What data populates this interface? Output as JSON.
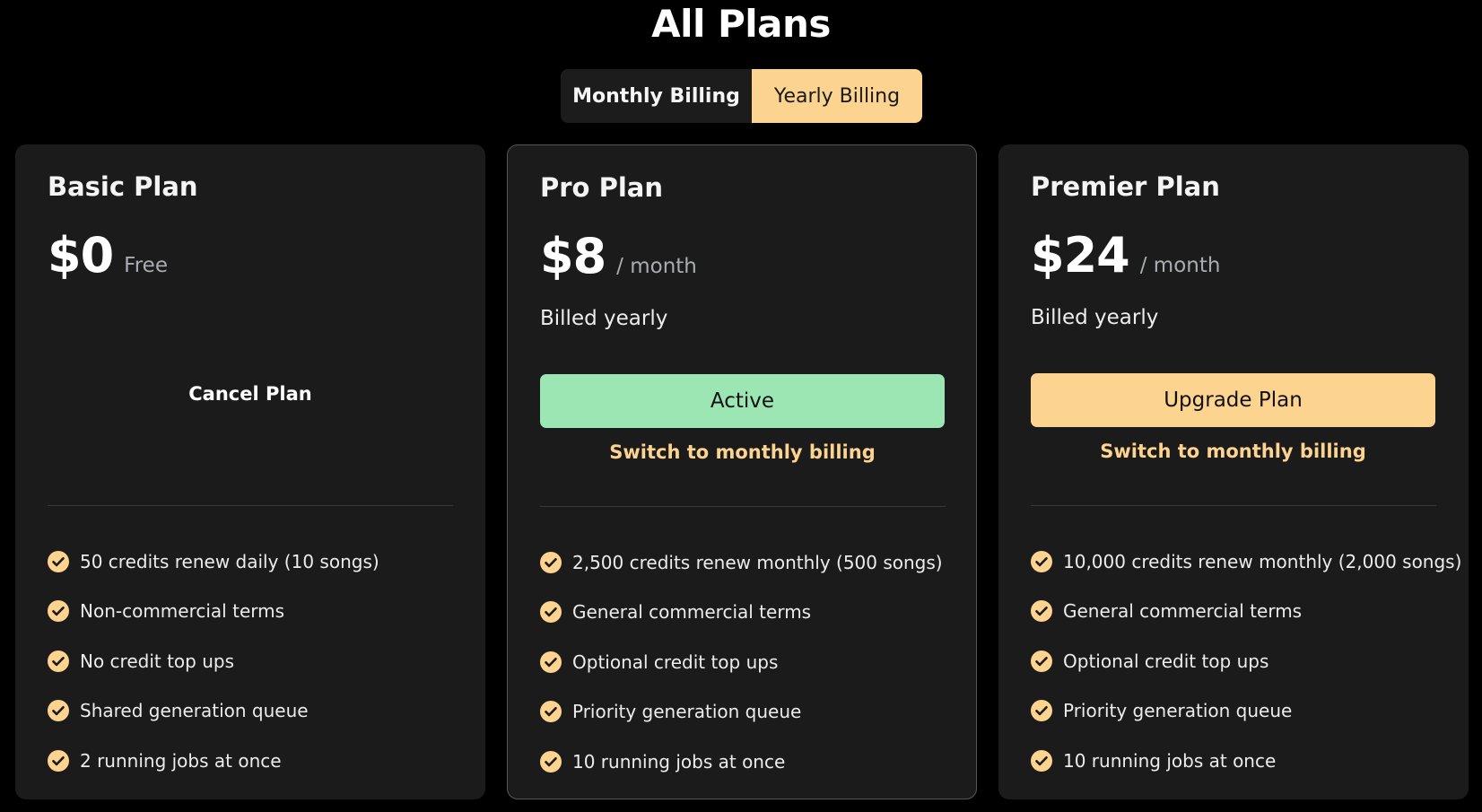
{
  "header": {
    "title": "All Plans"
  },
  "billing_toggle": {
    "monthly_label": "Monthly Billing",
    "yearly_label": "Yearly Billing",
    "selected": "yearly"
  },
  "colors": {
    "accent": "#fcd38f",
    "active": "#9be6b3",
    "card_bg": "#1b1b1c",
    "page_bg": "#000000"
  },
  "plans": {
    "basic": {
      "name": "Basic Plan",
      "price": "$0",
      "price_suffix": "Free",
      "action_label": "Cancel Plan",
      "features": [
        "50 credits renew daily (10 songs)",
        "Non-commercial terms",
        "No credit top ups",
        "Shared generation queue",
        "2 running jobs at once"
      ]
    },
    "pro": {
      "name": "Pro Plan",
      "price": "$8",
      "price_suffix": "/ month",
      "billed_note": "Billed yearly",
      "action_label": "Active",
      "switch_label": "Switch to monthly billing",
      "features": [
        "2,500 credits renew monthly (500 songs)",
        "General commercial terms",
        "Optional credit top ups",
        "Priority generation queue",
        "10 running jobs at once"
      ]
    },
    "premier": {
      "name": "Premier Plan",
      "price": "$24",
      "price_suffix": "/ month",
      "billed_note": "Billed yearly",
      "action_label": "Upgrade Plan",
      "switch_label": "Switch to monthly billing",
      "features": [
        "10,000 credits renew monthly (2,000 songs)",
        "General commercial terms",
        "Optional credit top ups",
        "Priority generation queue",
        "10 running jobs at once"
      ]
    }
  },
  "icons": {
    "feature_check": "check-circle-icon"
  }
}
